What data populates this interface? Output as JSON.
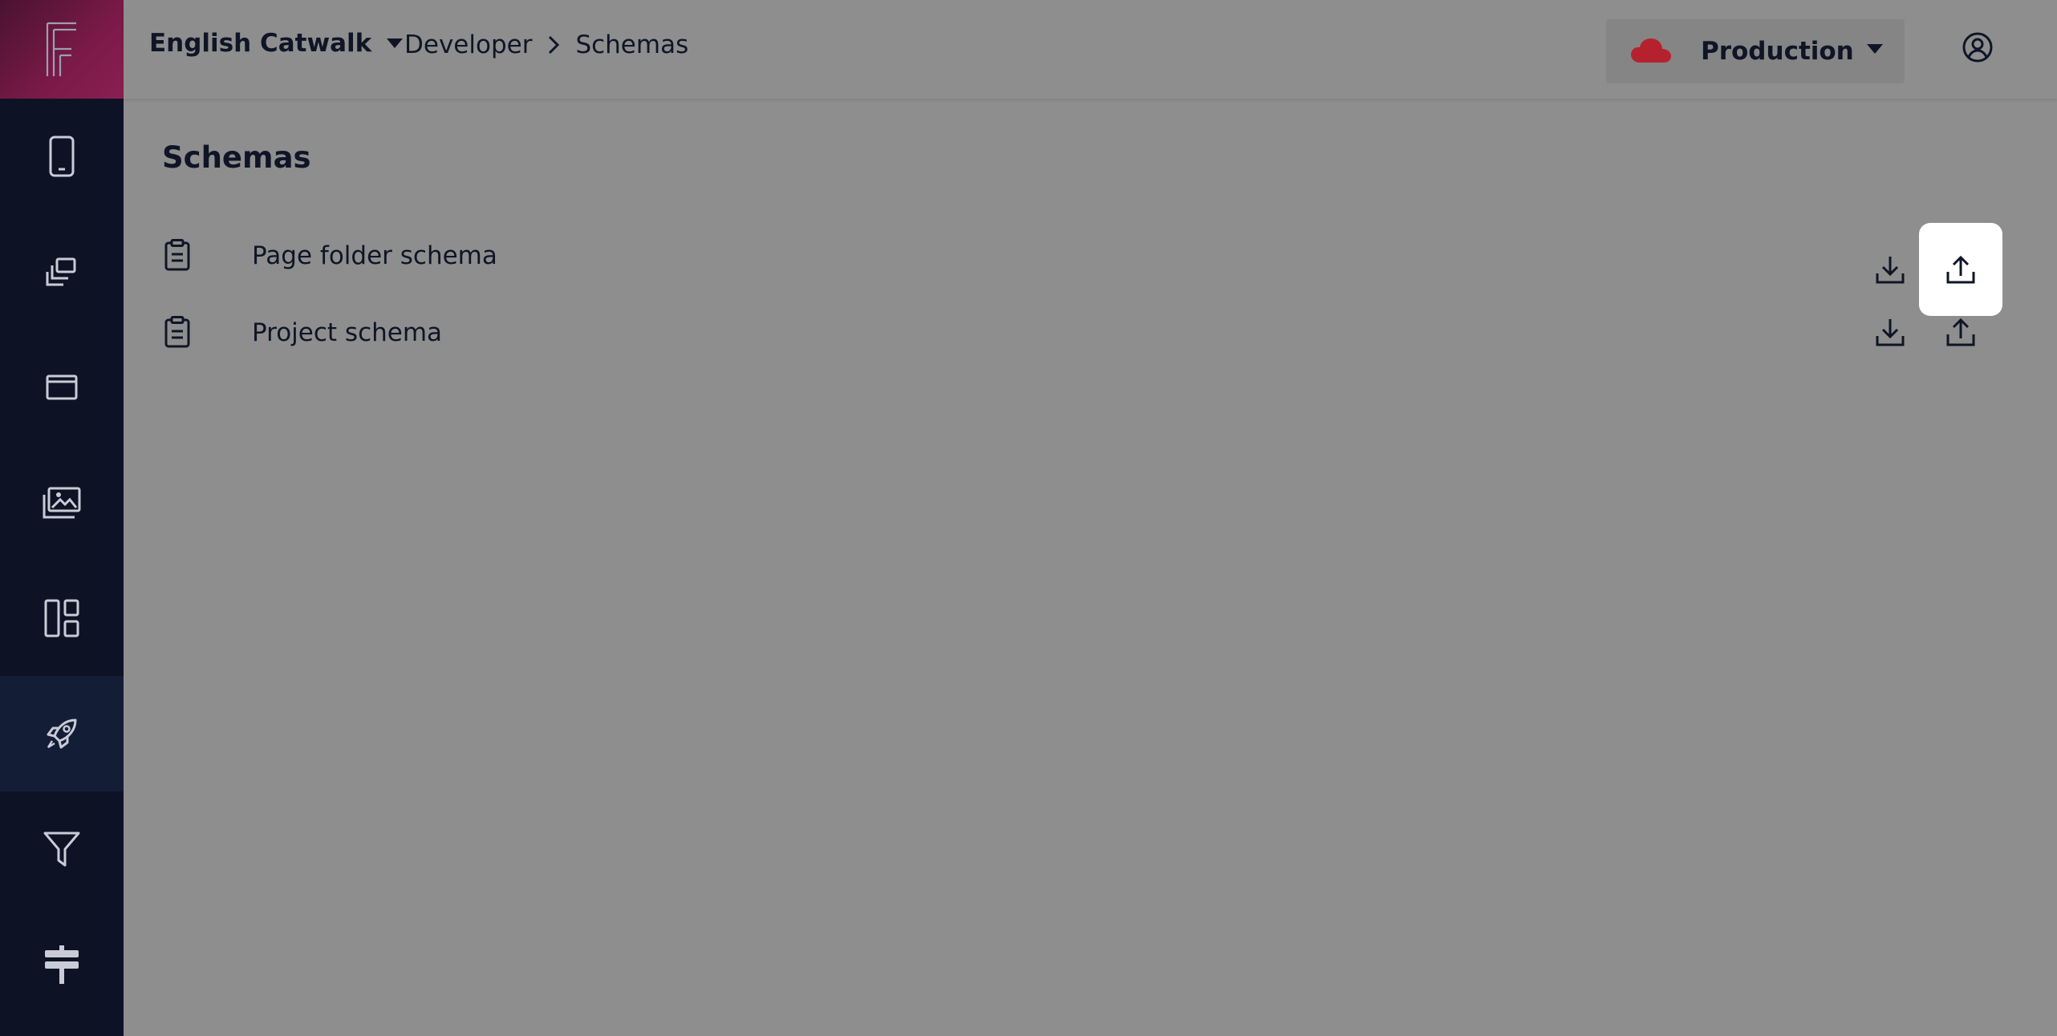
{
  "header": {
    "project_name": "English Catwalk",
    "breadcrumb": [
      "Developer",
      "Schemas"
    ],
    "environment": "Production",
    "colors": {
      "environment_cloud": "#b5222e",
      "brand_gradient": "#8c1e52"
    }
  },
  "sidebar": {
    "logo_icon": "frontastic-logo-icon",
    "items": [
      {
        "icon": "mobile-icon",
        "active": false
      },
      {
        "icon": "copy-icon",
        "active": false
      },
      {
        "icon": "window-icon",
        "active": false
      },
      {
        "icon": "images-icon",
        "active": false
      },
      {
        "icon": "layout-icon",
        "active": false
      },
      {
        "icon": "rocket-icon",
        "active": true
      },
      {
        "icon": "filter-icon",
        "active": false
      },
      {
        "icon": "signpost-icon",
        "active": false
      }
    ]
  },
  "main": {
    "title": "Schemas",
    "schemas": [
      {
        "label": "Page folder schema",
        "icon": "clipboard-icon",
        "actions": [
          "download-icon",
          "upload-icon"
        ]
      },
      {
        "label": "Project schema",
        "icon": "clipboard-icon",
        "actions": [
          "download-icon",
          "upload-icon"
        ]
      }
    ]
  }
}
